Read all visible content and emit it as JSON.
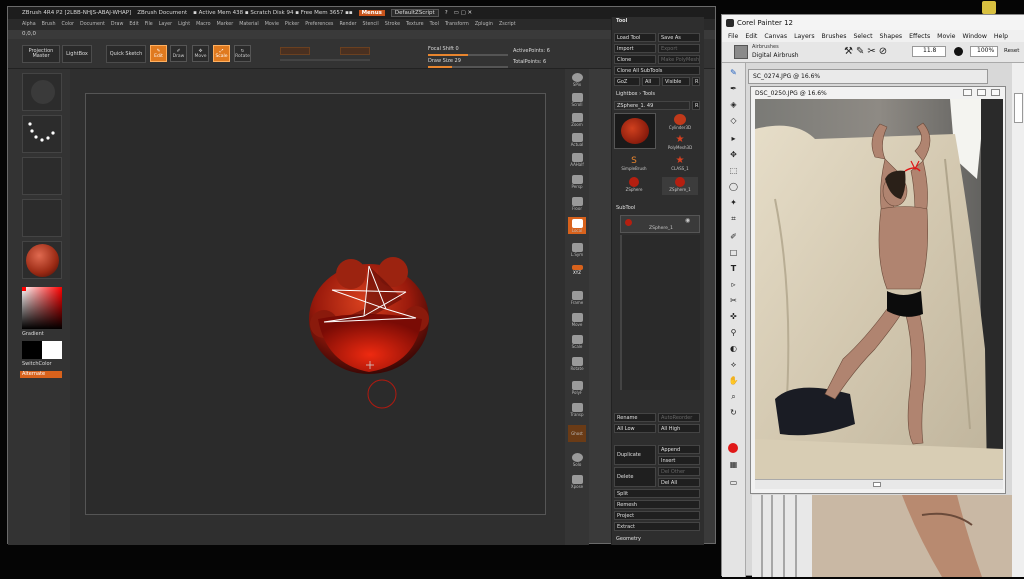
{
  "zbrush": {
    "title": "ZBrush 4R4 P2 [2LBB-NHJS-ABAJ-WHAP]",
    "doc": "ZBrush Document",
    "mem": "▪ Active Mem 438 ▪ Scratch Disk 94 ▪ Free Mem 3657 ▪▪",
    "menus_btn": "Menus",
    "script": "DefaultZScript",
    "menu": [
      "Alpha",
      "Brush",
      "Color",
      "Document",
      "Draw",
      "Edit",
      "File",
      "Layer",
      "Light",
      "Macro",
      "Marker",
      "Material",
      "Movie",
      "Picker",
      "Preferences",
      "Render",
      "Stencil",
      "Stroke",
      "Texture",
      "Tool",
      "Transform",
      "Zplugin",
      "Zscript"
    ],
    "coords": "0,0,0",
    "shelf": {
      "projection_master": "Projection Master",
      "lightbox": "LightBox",
      "quick_sketch": "Quick Sketch",
      "edit": "Edit",
      "draw": "Draw",
      "move": "Move",
      "scale": "Scale",
      "rotate": "Rotate",
      "focal_shift_label": "Focal Shift",
      "focal_shift": "0",
      "draw_size_label": "Draw Size",
      "draw_size": "29",
      "active_points_label": "ActivePoints:",
      "active_points": "6",
      "total_points_label": "TotalPoints:",
      "total_points": "6",
      "focal_shift_level": 0.5,
      "draw_size_level": 0.3
    },
    "left_labels": [
      "",
      "",
      "",
      "",
      ""
    ],
    "gradient": "Gradient",
    "switch_color": "SwitchColor",
    "alternate": "Alternate",
    "right_icons": [
      "SPix",
      "Scroll",
      "Zoom",
      "Actual",
      "AAHalf",
      "Persp",
      "Floor",
      "Local",
      "L.Sym",
      "XYZ",
      "Frame",
      "Move",
      "Scale",
      "Rotate",
      "PolyF",
      "Transp",
      "Ghost",
      "Solo",
      "Xpose"
    ],
    "panel": {
      "header": "Tool",
      "load": "Load Tool",
      "save": "Save As",
      "import": "Import",
      "export": "Export",
      "clone": "Clone",
      "make_polymesh": "Make PolyMesh3D",
      "clone_all": "Clone All SubTools",
      "goz": "GoZ",
      "all": "All",
      "visible": "Visible",
      "r": "R",
      "lightbox_tools": "Lightbox › Tools",
      "zsphere_label": "ZSphere_1. 49",
      "tools": [
        "Cylinder3D",
        "PolyMesh3D",
        "SimpleBrush",
        "CLASS_1",
        "ZSphere",
        "ZSphere_1"
      ],
      "subtool": "SubTool",
      "subtool_item": "ZSphere_1",
      "rename": "Rename",
      "autoreorder": "AutoReorder",
      "all_low": "All Low",
      "all_high": "All High",
      "duplicate": "Duplicate",
      "append": "Append",
      "insert": "Insert",
      "delete": "Delete",
      "del_other": "Del Other",
      "del_all": "Del All",
      "split": "Split",
      "remesh": "Remesh",
      "project": "Project",
      "extract": "Extract",
      "geometry": "Geometry"
    }
  },
  "painter": {
    "title": "Corel Painter 12",
    "menu": [
      "File",
      "Edit",
      "Canvas",
      "Layers",
      "Brushes",
      "Select",
      "Shapes",
      "Effects",
      "Movie",
      "Window",
      "Help"
    ],
    "brush_category": "Airbrushes",
    "brush_variant": "Digital Airbrush",
    "size": "11.8",
    "opacity": "100%",
    "reset": "Reset",
    "doc1": "SC_0274.JPG @ 16.6%",
    "doc2": "DSC_0250.JPG @ 16.6%"
  },
  "colors": {
    "accent": "#e07a1f",
    "zsphere": "#b51f10",
    "painter_bg": "#d8d8d8"
  }
}
